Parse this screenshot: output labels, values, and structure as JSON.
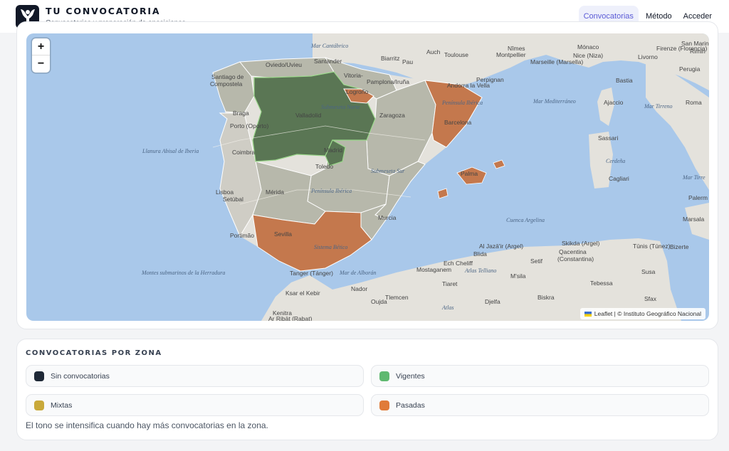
{
  "header": {
    "title": "TU CONVOCATORIA",
    "subtitle": "Convocatorias y preparación de oposiciones",
    "nav": [
      {
        "label": "Convocatorias",
        "active": true
      },
      {
        "label": "Método",
        "active": false
      },
      {
        "label": "Acceder",
        "active": false
      }
    ]
  },
  "map": {
    "zoom_in": "+",
    "zoom_out": "−",
    "attribution": "Leaflet | © Instituto Geográfico Nacional",
    "labels": [
      {
        "id": "mar-cantabrico",
        "text": "Mar Cantábrico"
      },
      {
        "id": "santander",
        "text": "Santander"
      },
      {
        "id": "oviedo",
        "text": "Oviedo/Uvieu"
      },
      {
        "id": "santiago-1",
        "text": "Santiago de"
      },
      {
        "id": "santiago-2",
        "text": "Compostela"
      },
      {
        "id": "vitoria",
        "text": "Vitoria-"
      },
      {
        "id": "pamplona",
        "text": "Pamplona/Iruña"
      },
      {
        "id": "logrono",
        "text": "Logroño"
      },
      {
        "id": "braga",
        "text": "Braga"
      },
      {
        "id": "porto",
        "text": "Porto (Oporto)"
      },
      {
        "id": "valladolid",
        "text": "Valladolid"
      },
      {
        "id": "zaragoza",
        "text": "Zaragoza"
      },
      {
        "id": "submeseta-norte",
        "text": "Submeseta Norte"
      },
      {
        "id": "peninsula-iberica-ne",
        "text": "Península Ibérica"
      },
      {
        "id": "barcelona",
        "text": "Barcelona"
      },
      {
        "id": "andorra",
        "text": "Andorra la Vella"
      },
      {
        "id": "perpignan",
        "text": "Perpignan"
      },
      {
        "id": "coimbra",
        "text": "Coimbra"
      },
      {
        "id": "llanura",
        "text": "Llanura Abisal de Iberia"
      },
      {
        "id": "madrid",
        "text": "Madrid"
      },
      {
        "id": "toledo",
        "text": "Toledo"
      },
      {
        "id": "submeseta-sur",
        "text": "Submeseta Sur"
      },
      {
        "id": "palma",
        "text": "Palma"
      },
      {
        "id": "lisboa",
        "text": "Lisboa"
      },
      {
        "id": "setubal",
        "text": "Setúbal"
      },
      {
        "id": "merida",
        "text": "Mérida"
      },
      {
        "id": "peninsula-iberica",
        "text": "Península Ibérica"
      },
      {
        "id": "murcia",
        "text": "Murcia"
      },
      {
        "id": "portimao",
        "text": "Portimão"
      },
      {
        "id": "sevilla",
        "text": "Sevilla"
      },
      {
        "id": "sistema-betico",
        "text": "Sistema Bético"
      },
      {
        "id": "cuenca-argelina",
        "text": "Cuenca Argelina"
      },
      {
        "id": "montes",
        "text": "Montes submarinos de la Herradura"
      },
      {
        "id": "tanger",
        "text": "Tanger (Tánger)"
      },
      {
        "id": "mar-alboran",
        "text": "Mar de Alborán"
      },
      {
        "id": "nador",
        "text": "Nador"
      },
      {
        "id": "ksar",
        "text": "Ksar el Kebir"
      },
      {
        "id": "tlemcen",
        "text": "Tlemcen"
      },
      {
        "id": "oujda",
        "text": "Oujda"
      },
      {
        "id": "kenitra",
        "text": "Kenitra"
      },
      {
        "id": "rabat",
        "text": "Ar Ribāt (Rabat)"
      },
      {
        "id": "atlas",
        "text": "Atlas"
      },
      {
        "id": "alger",
        "text": "Al Jazā'ir (Argel)"
      },
      {
        "id": "blida",
        "text": "Blida"
      },
      {
        "id": "ech-cheliff",
        "text": "Ech Cheliff"
      },
      {
        "id": "mostaganem",
        "text": "Mostaganem"
      },
      {
        "id": "atlas-telliano",
        "text": "Atlas Telliano"
      },
      {
        "id": "msila",
        "text": "M'sila"
      },
      {
        "id": "setif",
        "text": "Setif"
      },
      {
        "id": "tiaret",
        "text": "Tiaret"
      },
      {
        "id": "biskra",
        "text": "Biskra"
      },
      {
        "id": "djelfa",
        "text": "Djelfa"
      },
      {
        "id": "skikda",
        "text": "Skikda (Argel)"
      },
      {
        "id": "qacentina-1",
        "text": "Qacentina"
      },
      {
        "id": "qacentina-2",
        "text": "(Constantina)"
      },
      {
        "id": "tebessa",
        "text": "Tebessa"
      },
      {
        "id": "tunis",
        "text": "Tūnis (Túnez)"
      },
      {
        "id": "susa",
        "text": "Susa"
      },
      {
        "id": "sfax",
        "text": "Sfax"
      },
      {
        "id": "mar-mediterraneo",
        "text": "Mar Mediterráneo"
      },
      {
        "id": "ajaccio",
        "text": "Ajaccio"
      },
      {
        "id": "bastia",
        "text": "Bastia"
      },
      {
        "id": "sassari",
        "text": "Sassari"
      },
      {
        "id": "cerdena",
        "text": "Cerdeña"
      },
      {
        "id": "cagliari",
        "text": "Cagliari"
      },
      {
        "id": "mar-tirreno",
        "text": "Mar Tirreno"
      },
      {
        "id": "mar-tirre",
        "text": "Mar Tirre"
      },
      {
        "id": "roma",
        "text": "Roma"
      },
      {
        "id": "perugia",
        "text": "Perugia"
      },
      {
        "id": "firenze",
        "text": "Firenze (Florencia)"
      },
      {
        "id": "san-marino",
        "text": "San Marino"
      },
      {
        "id": "rimini",
        "text": "Rimin"
      },
      {
        "id": "livorno",
        "text": "Livorno"
      },
      {
        "id": "monaco",
        "text": "Mónaco"
      },
      {
        "id": "nice",
        "text": "Nice (Niza)"
      },
      {
        "id": "nimes",
        "text": "Nîmes"
      },
      {
        "id": "montpellier",
        "text": "Montpellier"
      },
      {
        "id": "marseille",
        "text": "Marseille (Marsella)"
      },
      {
        "id": "toulouse",
        "text": "Toulouse"
      },
      {
        "id": "auch",
        "text": "Auch"
      },
      {
        "id": "biarritz",
        "text": "Biarritz"
      },
      {
        "id": "pau",
        "text": "Pau"
      },
      {
        "id": "marsala",
        "text": "Marsala"
      },
      {
        "id": "palerm",
        "text": "Palerm"
      },
      {
        "id": "bizerte",
        "text": "Bizerte"
      }
    ]
  },
  "legend": {
    "title": "CONVOCATORIAS POR ZONA",
    "items": [
      {
        "label": "Sin convocatorias",
        "color": "#1f2937"
      },
      {
        "label": "Vigentes",
        "color": "#5fb970"
      },
      {
        "label": "Mixtas",
        "color": "#c9a93a"
      },
      {
        "label": "Pasadas",
        "color": "#e07b39"
      }
    ],
    "note": "El tono se intensifica cuando hay más convocatorias en la zona."
  },
  "colors": {
    "accent": "#5b5bd6",
    "sea": "#a9c8ea",
    "land": "#e4e2dc",
    "region_neutral": "#b3b4a7",
    "region_vigentes": "#5a7654",
    "region_pasadas": "#c4784d"
  }
}
